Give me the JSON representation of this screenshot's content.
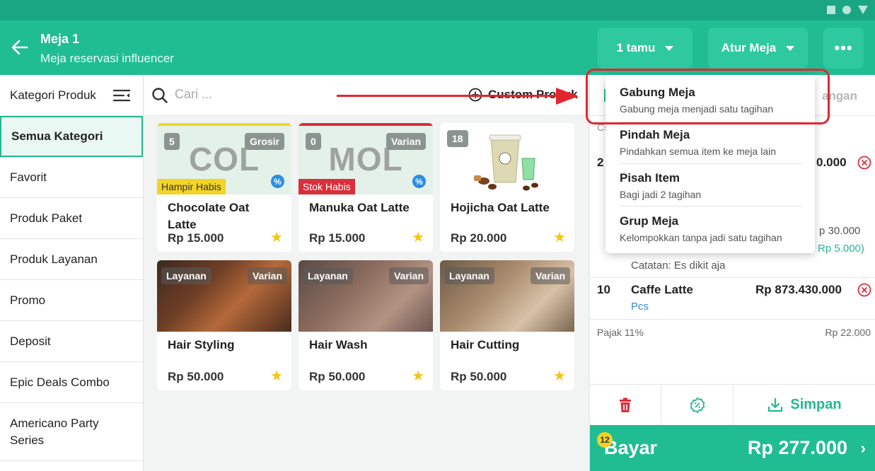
{
  "header": {
    "title": "Meja 1",
    "subtitle": "Meja reservasi influencer",
    "guests_label": "1 tamu",
    "table_settings_label": "Atur Meja",
    "more_label": "•••"
  },
  "sidebar": {
    "heading": "Kategori Produk",
    "items": [
      {
        "label": "Semua Kategori"
      },
      {
        "label": "Favorit"
      },
      {
        "label": "Produk Paket"
      },
      {
        "label": "Produk Layanan"
      },
      {
        "label": "Promo"
      },
      {
        "label": "Deposit"
      },
      {
        "label": "Epic Deals Combo"
      },
      {
        "label": "Americano Party Series"
      }
    ]
  },
  "search": {
    "placeholder": "Cari ...",
    "custom_product_label": "Custom Produk"
  },
  "products": [
    {
      "name": "Chocolate Oat Latte",
      "price": "Rp 15.000",
      "count": "5",
      "tag": "Grosir",
      "initials": "COL",
      "stock": "Hampir Habis",
      "discount": "%"
    },
    {
      "name": "Manuka Oat Latte",
      "price": "Rp 15.000",
      "count": "0",
      "tag": "Varian",
      "initials": "MOL",
      "stock": "Stok Habis",
      "discount": "%"
    },
    {
      "name": "Hojicha Oat Latte",
      "price": "Rp 20.000",
      "count": "18"
    },
    {
      "name": "Hair Styling",
      "price": "Rp 50.000",
      "badge": "Layanan",
      "tag": "Varian"
    },
    {
      "name": "Hair Wash",
      "price": "Rp 50.000",
      "badge": "Layanan",
      "tag": "Varian"
    },
    {
      "name": "Hair Cutting",
      "price": "Rp 50.000",
      "badge": "Layanan",
      "tag": "Varian"
    }
  ],
  "order": {
    "tab_right": "angan",
    "cs": "Cs",
    "item1_qty": "2",
    "item1_amount": "0.000",
    "item1_sub": "p 30.000",
    "item1_discount": "Rp 5.000)",
    "item1_note": "Catatan: Es dikit aja",
    "item2_qty": "10",
    "item2_name": "Caffe Latte",
    "item2_unit": "Pcs",
    "item2_price": "Rp 873.430.000",
    "tax_label": "Pajak 11%",
    "tax_value": "Rp 22.000",
    "save_label": "Simpan",
    "pay_badge": "12",
    "pay_label": "Bayar",
    "pay_total": "Rp 277.000"
  },
  "menu": {
    "items": [
      {
        "title": "Gabung Meja",
        "desc": "Gabung meja menjadi satu tagihan"
      },
      {
        "title": "Pindah Meja",
        "desc": "Pindahkan semua item ke meja lain"
      },
      {
        "title": "Pisah Item",
        "desc": "Bagi jadi 2 tagihan"
      },
      {
        "title": "Grup Meja",
        "desc": "Kelompokkan tanpa jadi satu tagihan"
      }
    ]
  },
  "colors": {
    "primary": "#20bd93",
    "status_bar": "#1aa583",
    "annotation": "#e3262e",
    "favorite": "#f4c417"
  }
}
